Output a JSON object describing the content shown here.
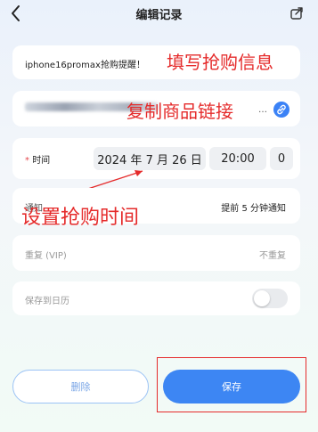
{
  "nav": {
    "back_icon": "chevron-left-icon",
    "title": "编辑记录",
    "share_icon": "share-icon"
  },
  "name_row": {
    "value": "iphone16promax抢购提醒！",
    "annotation": "填写抢购信息"
  },
  "url_row": {
    "annotation": "复制商品链接",
    "link_icon": "link-icon"
  },
  "time_row": {
    "required_mark": "*",
    "label": "时间",
    "date": "2024 年 7 月 26 日",
    "time": "20:00",
    "seconds": "0"
  },
  "notify_row": {
    "label": "通知",
    "value": "提前 5 分钟通知",
    "annotation": "设置抢购时间"
  },
  "repeat_row": {
    "label": "重复 (VIP)",
    "value": "不重复"
  },
  "calendar_row": {
    "label": "保存到日历",
    "toggle_on": false
  },
  "actions": {
    "delete_label": "删除",
    "save_label": "保存"
  },
  "colors": {
    "accent": "#3d86f3",
    "annotation": "#e52b2b"
  }
}
